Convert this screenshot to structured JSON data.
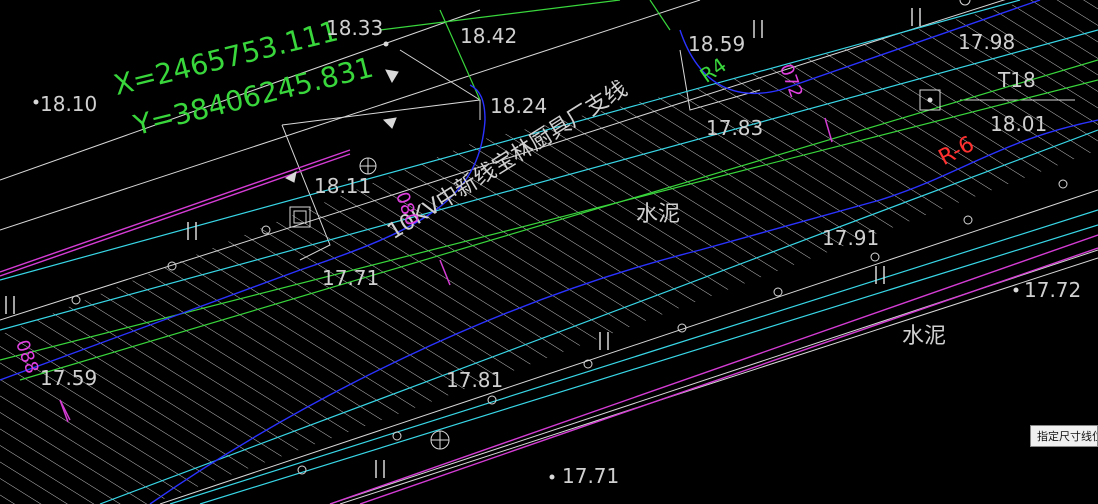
{
  "coords": {
    "x_text": "X=2465753.111",
    "y_text": "Y=38406245.831"
  },
  "elevations": [
    {
      "id": "e1810",
      "text": "18.10"
    },
    {
      "id": "e1833",
      "text": "18.33"
    },
    {
      "id": "e1842",
      "text": "18.42"
    },
    {
      "id": "e1824",
      "text": "18.24"
    },
    {
      "id": "e1859",
      "text": "18.59"
    },
    {
      "id": "e1798",
      "text": "17.98"
    },
    {
      "id": "e1783",
      "text": "17.83"
    },
    {
      "id": "e1801",
      "text": "18.01"
    },
    {
      "id": "e1811",
      "text": "18.11"
    },
    {
      "id": "e1771a",
      "text": "17.71"
    },
    {
      "id": "e1791",
      "text": "17.91"
    },
    {
      "id": "e1772",
      "text": "17.72"
    },
    {
      "id": "e1759",
      "text": "17.59"
    },
    {
      "id": "e1781",
      "text": "17.81"
    },
    {
      "id": "e1771b",
      "text": "17.71"
    }
  ],
  "labels": {
    "cable_line": "10KV中新线宝林厨具厂支线",
    "cement_1": "水泥",
    "cement_2": "水泥",
    "tag_t18": "T18",
    "radius": "R-6",
    "r4": "R4",
    "dim_072": "072",
    "dim_080": "080",
    "dim_088": "088"
  },
  "tooltip": {
    "text": "指定尺寸线位置"
  },
  "colors": {
    "background": "#000000",
    "green": "#39d63c",
    "cyan": "#38d6e6",
    "blue": "#2a32ff",
    "magenta": "#d43cd4",
    "white": "#d8d8d8",
    "red": "#ff3030"
  }
}
